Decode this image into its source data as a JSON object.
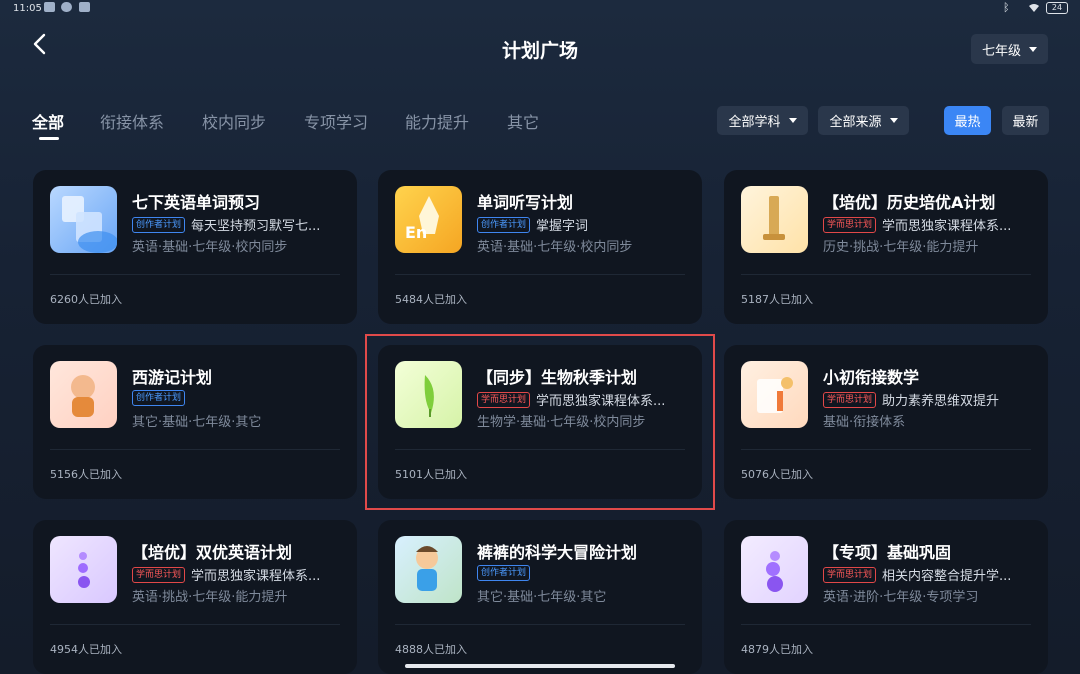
{
  "status": {
    "time": "11:05",
    "battery": "24"
  },
  "header": {
    "title": "计划广场",
    "grade": "七年级"
  },
  "tabs": [
    "全部",
    "衔接体系",
    "校内同步",
    "专项学习",
    "能力提升",
    "其它"
  ],
  "filters": {
    "subject": "全部学科",
    "source": "全部来源",
    "hot": "最热",
    "newest": "最新"
  },
  "cards": [
    {
      "title": "七下英语单词预习",
      "tag": "创作者计划",
      "desc": "每天坚持预习默写七...",
      "meta": "英语·基础·七年级·校内同步",
      "joined": "6260人已加入"
    },
    {
      "title": "单词听写计划",
      "tag": "创作者计划",
      "desc": "掌握字词",
      "meta": "英语·基础·七年级·校内同步",
      "joined": "5484人已加入"
    },
    {
      "title": "【培优】历史培优A计划",
      "tag": "学而思计划",
      "desc": "学而思独家课程体系...",
      "meta": "历史·挑战·七年级·能力提升",
      "joined": "5187人已加入"
    },
    {
      "title": "西游记计划",
      "tag": "创作者计划",
      "desc": "",
      "meta": "其它·基础·七年级·其它",
      "joined": "5156人已加入"
    },
    {
      "title": "【同步】生物秋季计划",
      "tag": "学而思计划",
      "desc": "学而思独家课程体系...",
      "meta": "生物学·基础·七年级·校内同步",
      "joined": "5101人已加入"
    },
    {
      "title": "小初衔接数学",
      "tag": "学而思计划",
      "desc": "助力素养思维双提升",
      "meta": "基础·衔接体系",
      "joined": "5076人已加入"
    },
    {
      "title": "【培优】双优英语计划",
      "tag": "学而思计划",
      "desc": "学而思独家课程体系...",
      "meta": "英语·挑战·七年级·能力提升",
      "joined": "4954人已加入"
    },
    {
      "title": "裤裤的科学大冒险计划",
      "tag": "创作者计划",
      "desc": "",
      "meta": "其它·基础·七年级·其它",
      "joined": "4888人已加入"
    },
    {
      "title": "【专项】基础巩固",
      "tag": "学而思计划",
      "desc": "相关内容整合提升学...",
      "meta": "英语·进阶·七年级·专项学习",
      "joined": "4879人已加入"
    }
  ],
  "colors": {
    "accent": "#3b86f5",
    "creator_tag": "#4c9bff",
    "xueersi_tag": "#ff5a5a",
    "highlight": "#e04a4a"
  }
}
